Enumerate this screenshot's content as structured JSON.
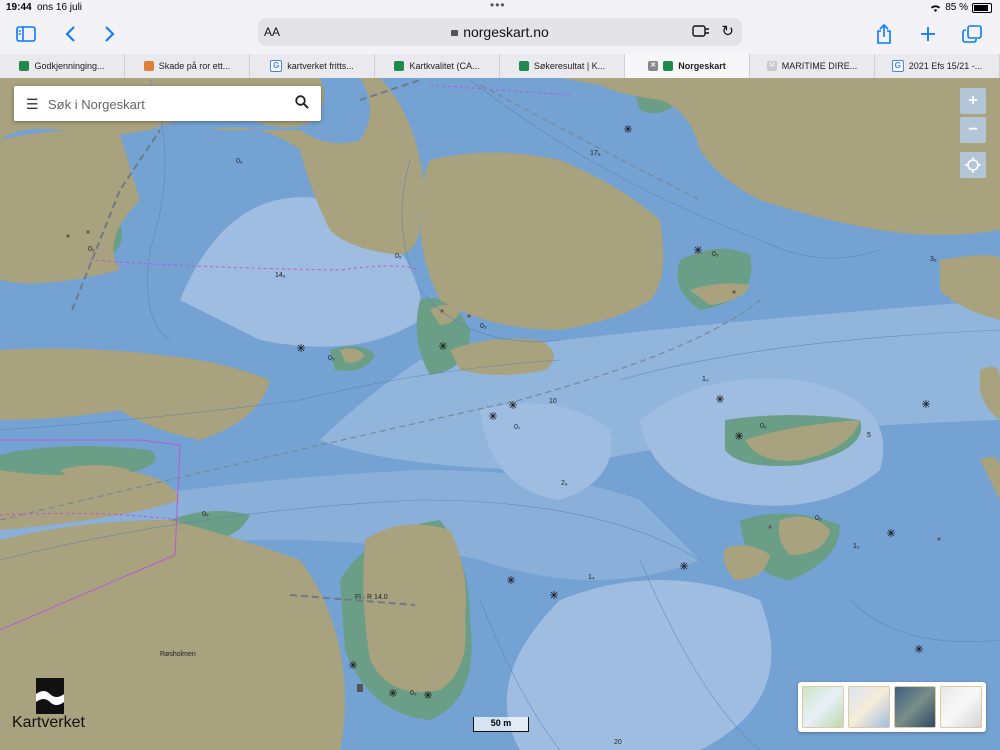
{
  "status": {
    "time": "19:44",
    "date": "ons 16 juli",
    "battery": "85 %",
    "battery_fraction": 0.85
  },
  "toolbar": {
    "text_size": "AA",
    "url": "norgeskart.no"
  },
  "tabs": [
    {
      "label": "Godkjenninging...",
      "fav_color": "#1f8a4c"
    },
    {
      "label": "Skade på ror ett...",
      "fav_color": "#e0803a"
    },
    {
      "label": "kartverket fritts...",
      "fav_color": "#4285f4"
    },
    {
      "label": "Kartkvalitet (CA...",
      "fav_color": "#1f8a4c"
    },
    {
      "label": "Søkeresultat | K...",
      "fav_color": "#1f8a4c"
    },
    {
      "label": "Norgeskart",
      "fav_color": "#1f8a4c"
    },
    {
      "label": "MARITIME DIRE...",
      "fav_color": "#c8c8c8"
    },
    {
      "label": "2021 Efs 15/21 -...",
      "fav_color": "#4285f4"
    }
  ],
  "search": {
    "placeholder": "Søk i Norgeskart"
  },
  "map": {
    "colors": {
      "land": "#a8a27e",
      "shallow": "#6f9fd2",
      "deep": "#9fbde0",
      "intertidal": "#6b9e86"
    },
    "labels": [
      "0₅",
      "14₉",
      "17₉",
      "1₀",
      "0₇",
      "2₉",
      "1₂",
      "1₄",
      "3₆",
      "10",
      "5",
      "Røsholmen",
      "Fl · R 14.0",
      "20"
    ],
    "zoom_in": "+",
    "zoom_out": "−"
  },
  "logo": {
    "name": "Kartverket"
  },
  "scale": {
    "label": "50 m"
  }
}
